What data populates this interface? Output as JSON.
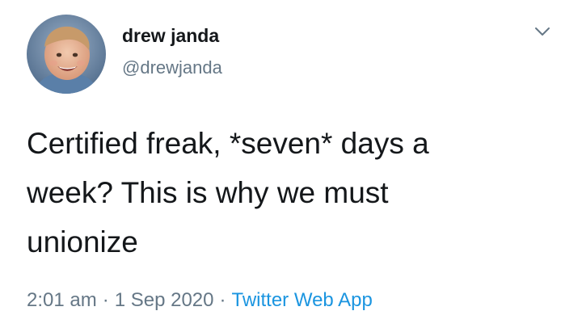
{
  "tweet": {
    "display_name": "drew janda",
    "handle": "@drewjanda",
    "text": "Certified freak, *seven* days a\nweek? This is why we must\nunionize",
    "time": "2:01 am",
    "date": "1 Sep 2020",
    "separator": "·",
    "source": "Twitter Web App",
    "menu_icon": "chevron-down-icon",
    "colors": {
      "name": "#14171a",
      "secondary": "#657786",
      "link": "#1b95e0",
      "background": "#ffffff"
    }
  }
}
